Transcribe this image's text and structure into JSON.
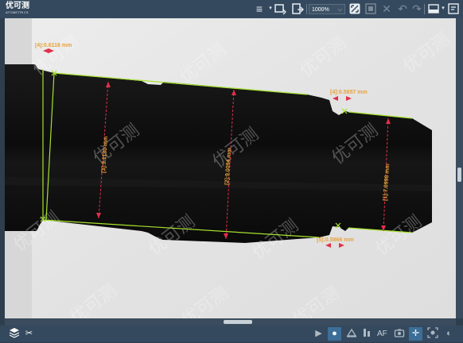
{
  "app": {
    "logo_cn": "优可测",
    "logo_en": "ATOMETRICS",
    "watermark": "优可测"
  },
  "toolbar": {
    "zoom_value": "1000%",
    "icons": [
      "menu-icon",
      "select-region-icon",
      "export-icon",
      "fit-icon",
      "grid-icon",
      "delete-icon",
      "undo-icon",
      "redo-icon",
      "layout-icon",
      "settings-icon"
    ]
  },
  "measurements": [
    {
      "label": "[4]:0.6116 mm"
    },
    {
      "label": "[3]:9.1130 mm"
    },
    {
      "label": "[2]:9.0094 mm"
    },
    {
      "label": "[4]:0.5657 mm"
    },
    {
      "label": "[1]:7.0998 mm"
    },
    {
      "label": "[5]:0.5866 mm"
    }
  ],
  "bottom": {
    "af_label": "AF",
    "icons": [
      "layers-icon",
      "tools-icon",
      "play-icon",
      "record-icon",
      "edge-icon",
      "stage-icon",
      "autofocus-icon",
      "camera-icon",
      "crosshair-icon",
      "capture-icon",
      "contrast-icon"
    ]
  },
  "colors": {
    "annotation": "#e8a13a",
    "arrow": "#e0304a",
    "edge": "#a6e22e"
  }
}
